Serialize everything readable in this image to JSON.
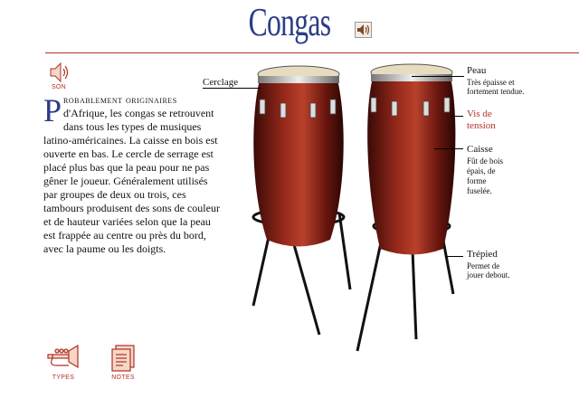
{
  "title": "Congas",
  "buttons": {
    "sound_label": "SON",
    "types_label": "TYPES",
    "notes_label": "NOTES"
  },
  "description": {
    "dropcap": "P",
    "lead": "robablement originaires",
    "body": "d'Afrique, les congas se retrouvent dans tous les types de musiques latino-américaines. La caisse en bois est ouverte en bas. Le cercle de serrage est placé plus bas que la peau pour ne pas gêner le joueur. Généralement utilisés par groupes de deux ou trois, ces tambours produisent des sons de couleur et de hauteur variées selon que la peau est frappée au centre ou près du bord, avec la paume ou les doigts."
  },
  "labels": {
    "cerclage": "Cerclage",
    "peau": {
      "title": "Peau",
      "desc1": "Très épaisse et",
      "desc2": "fortement tendue."
    },
    "vis": {
      "line1": "Vis de",
      "line2": "tension"
    },
    "caisse": {
      "title": "Caisse",
      "desc1": "Fût de bois",
      "desc2": "épais, de",
      "desc3": "forme",
      "desc4": "fuselée."
    },
    "trepied": {
      "title": "Trépied",
      "desc1": "Permet de",
      "desc2": "jouer debout."
    }
  },
  "colors": {
    "title_blue": "#2b3d85",
    "accent_red": "#b03028",
    "drum_wood": "#7a1a12"
  },
  "icons": {
    "speaker": "speaker-icon",
    "trumpet": "trumpet-icon",
    "notes": "notes-stack-icon"
  }
}
